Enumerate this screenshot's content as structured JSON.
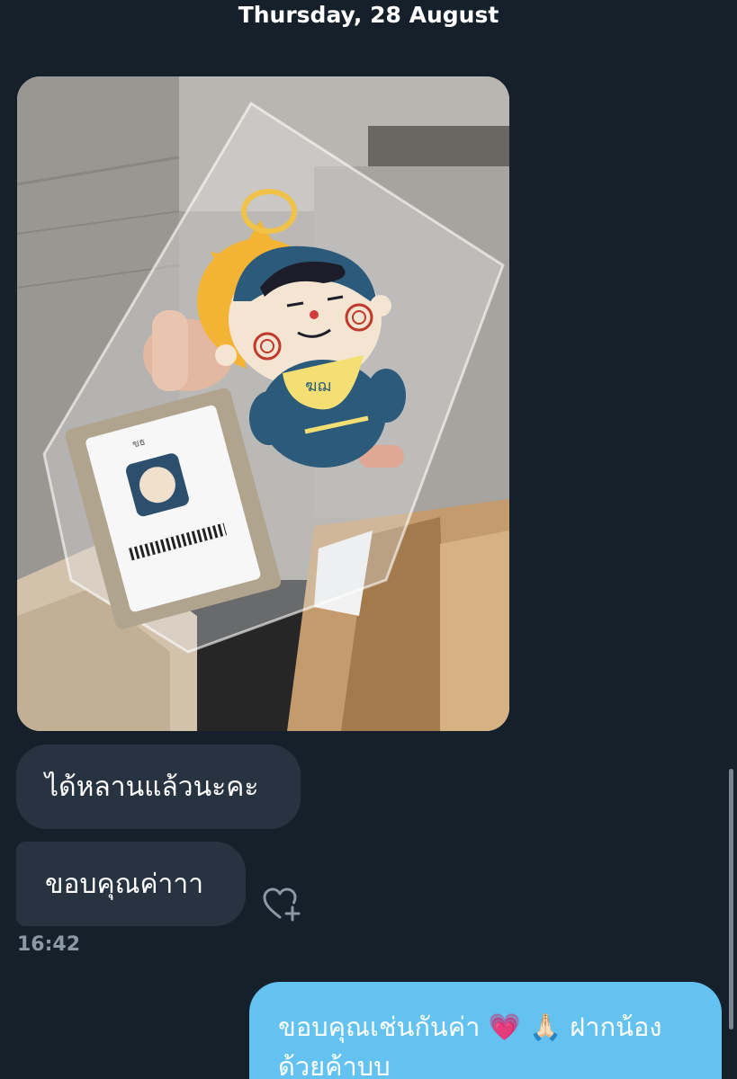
{
  "conversation": {
    "date_header": "Thursday, 28 August"
  },
  "messages": {
    "received_1": "ได้หลานแล้วนะคะ",
    "received_2": "ขอบคุณค่าาา",
    "received_time": "16:42",
    "sent_1": "ขอบคุณเช่นกันค่า 💗 🙏🏻 ฝากน้องด้วยค้าบบ"
  },
  "photo": {
    "card_text": "ขธ",
    "bib_text": "ฆฌ"
  },
  "icons": {
    "like": "heart-plus-icon"
  },
  "colors": {
    "background": "#15202b",
    "received_bubble": "#273340",
    "sent_bubble": "#63c2f0",
    "timestamp": "#8b98a5"
  }
}
